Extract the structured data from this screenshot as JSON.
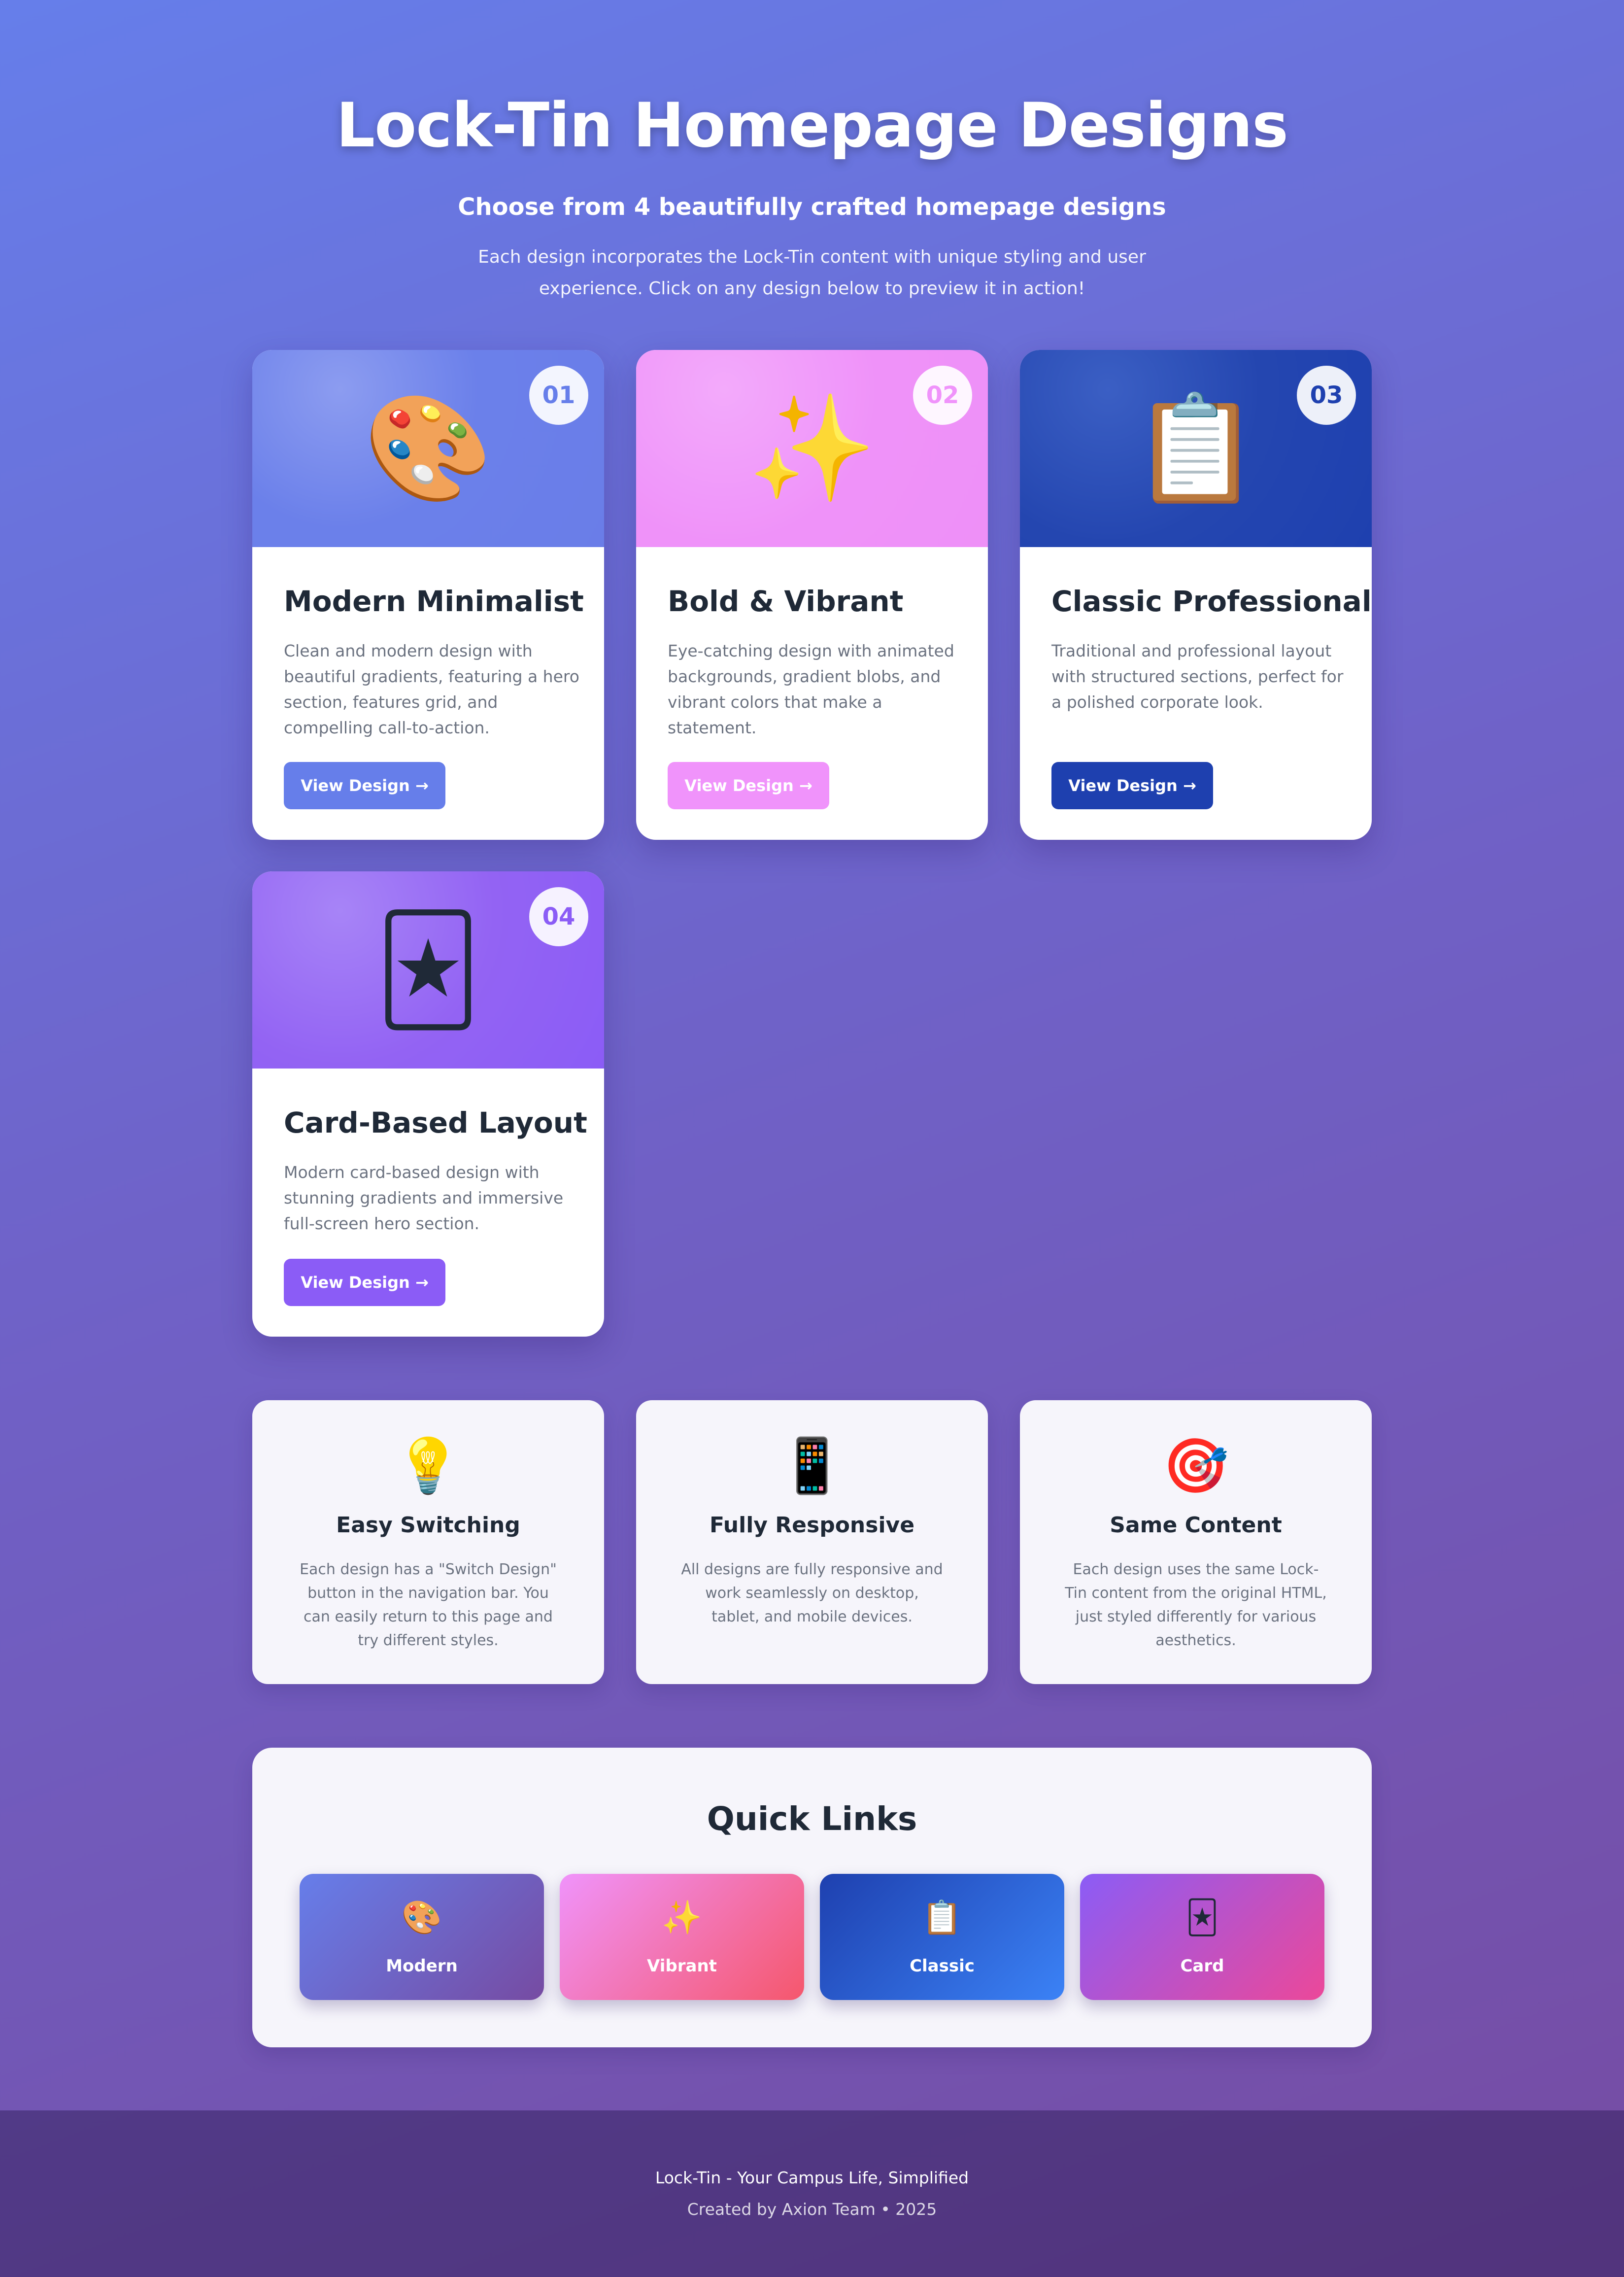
{
  "hero": {
    "title": "Lock-Tin Homepage Designs",
    "subtitle": "Choose from 4 beautifully crafted homepage designs",
    "description": "Each design incorporates the Lock-Tin content with unique styling and user experience. Click on any design below to preview it in action!"
  },
  "designs": [
    {
      "number": "01",
      "icon": "🎨",
      "icon_name": "palette-icon",
      "title": "Modern Minimalist",
      "description": "Clean and modern design with beautiful gradients, featuring a hero section, features grid, and compelling call-to-action.",
      "button": "View Design →",
      "accent": "#667eea"
    },
    {
      "number": "02",
      "icon": "✨",
      "icon_name": "sparkles-icon",
      "title": "Bold & Vibrant",
      "description": "Eye-catching design with animated backgrounds, gradient blobs, and vibrant colors that make a statement.",
      "button": "View Design →",
      "accent": "#f093fb"
    },
    {
      "number": "03",
      "icon": "📋",
      "icon_name": "clipboard-icon",
      "title": "Classic Professional",
      "description": "Traditional and professional layout with structured sections, perfect for a polished corporate look.",
      "button": "View Design →",
      "accent": "#1e40af"
    },
    {
      "number": "04",
      "icon": "🃏",
      "icon_name": "joker-card-icon",
      "title": "Card-Based Layout",
      "description": "Modern card-based design with stunning gradients and immersive full-screen hero section.",
      "button": "View Design →",
      "accent": "#8b5cf6"
    }
  ],
  "features": [
    {
      "icon": "💡",
      "icon_name": "lightbulb-icon",
      "title": "Easy Switching",
      "description": "Each design has a \"Switch Design\" button in the navigation bar. You can easily return to this page and try different styles."
    },
    {
      "icon": "📱",
      "icon_name": "mobile-phone-icon",
      "title": "Fully Responsive",
      "description": "All designs are fully responsive and work seamlessly on desktop, tablet, and mobile devices."
    },
    {
      "icon": "🎯",
      "icon_name": "target-icon",
      "title": "Same Content",
      "description": "Each design uses the same Lock-Tin content from the original HTML, just styled differently for various aesthetics."
    }
  ],
  "quick_links": {
    "title": "Quick Links",
    "items": [
      {
        "icon": "🎨",
        "icon_name": "palette-icon",
        "label": "Modern"
      },
      {
        "icon": "✨",
        "icon_name": "sparkles-icon",
        "label": "Vibrant"
      },
      {
        "icon": "📋",
        "icon_name": "clipboard-icon",
        "label": "Classic"
      },
      {
        "icon": "🃏",
        "icon_name": "joker-card-icon",
        "label": "Card"
      }
    ]
  },
  "footer": {
    "tagline": "Lock-Tin - Your Campus Life, Simplified",
    "credits": "Created by Axion Team • 2025"
  }
}
